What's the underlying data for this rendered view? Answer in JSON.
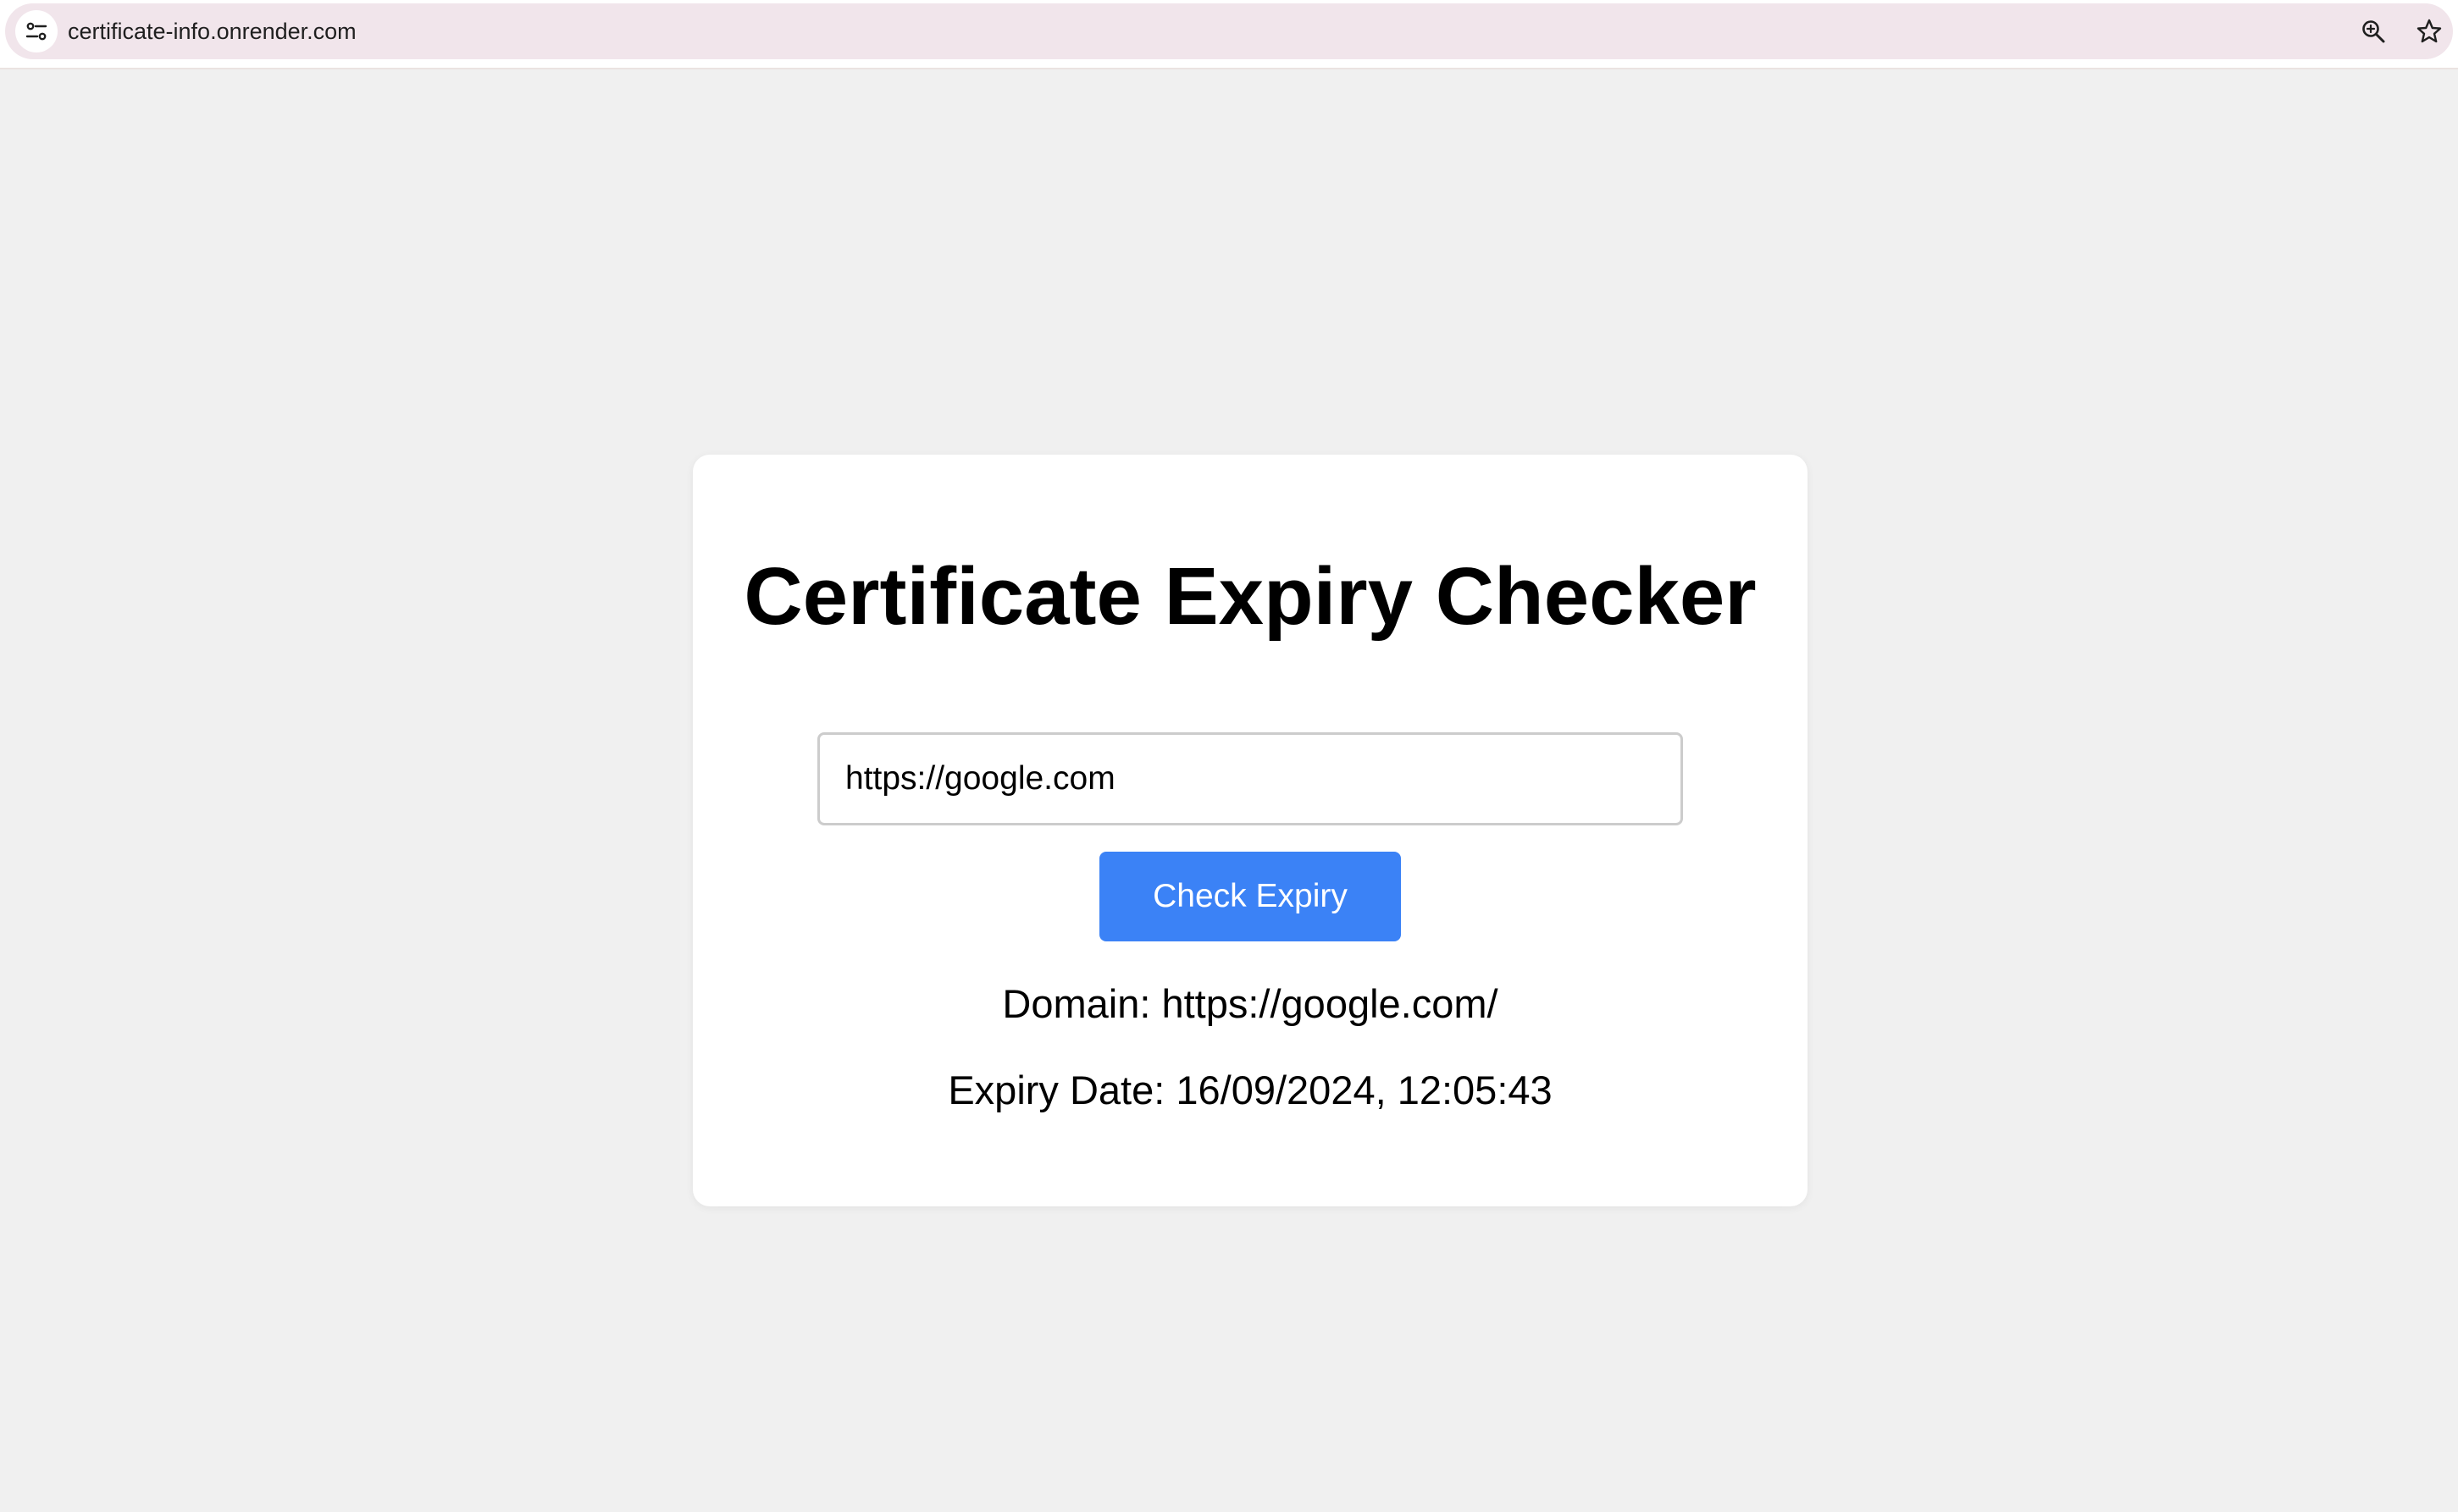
{
  "browser": {
    "url": "certificate-info.onrender.com",
    "icons": [
      "site-settings-icon",
      "zoom-icon",
      "bookmark-star-icon"
    ]
  },
  "app": {
    "title": "Certificate Expiry Checker",
    "input": {
      "value": "https://google.com",
      "placeholder": ""
    },
    "button_label": "Check Expiry",
    "result": {
      "domain_text": "Domain: https://google.com/",
      "expiry_text": "Expiry Date: 16/09/2024, 12:05:43"
    }
  },
  "colors": {
    "page_background": "#f0f0f0",
    "card_background": "#ffffff",
    "button_background": "#3b82f6",
    "omnibox_background": "#f1e5eb"
  }
}
